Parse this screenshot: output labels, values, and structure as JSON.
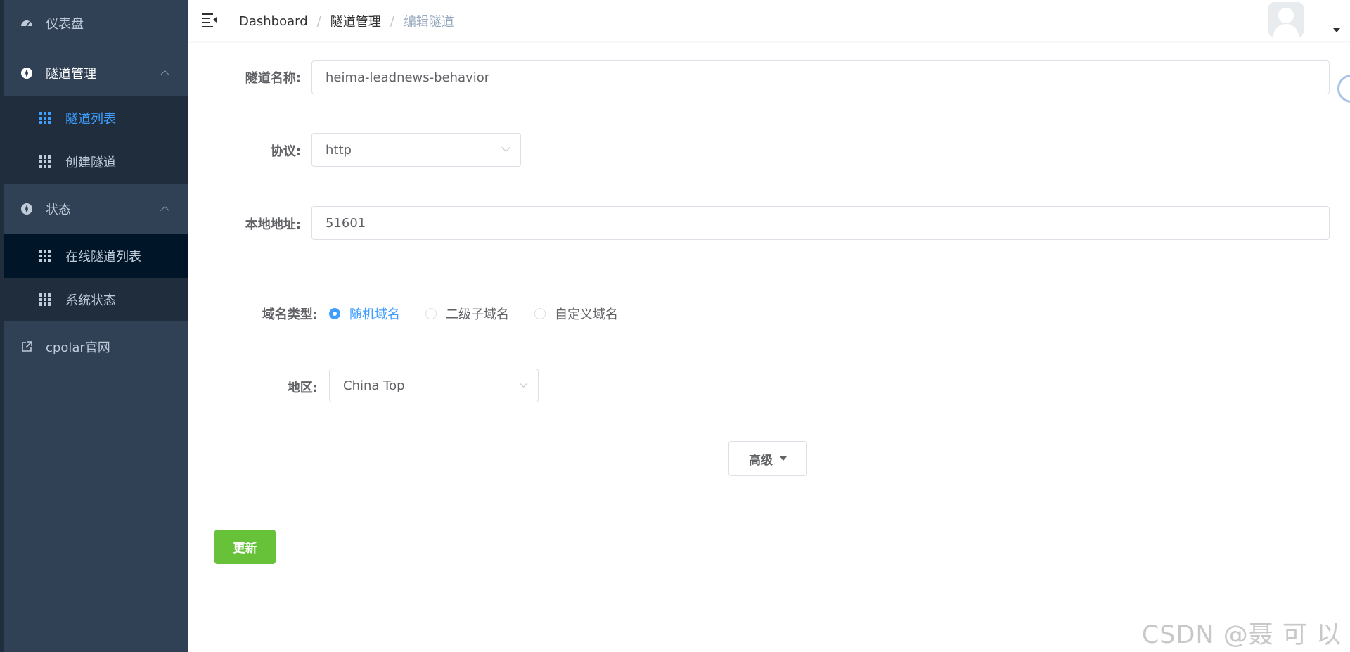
{
  "sidebar": {
    "dashboard": "仪表盘",
    "tunnel_mgmt": "隧道管理",
    "tunnel_list": "隧道列表",
    "create_tunnel": "创建隧道",
    "status": "状态",
    "online_tunnels": "在线隧道列表",
    "system_status": "系统状态",
    "official_site": "cpolar官网"
  },
  "breadcrumb": {
    "home": "Dashboard",
    "sep1": "/",
    "section": "隧道管理",
    "sep2": "/",
    "current": "编辑隧道"
  },
  "form": {
    "tunnel_name_label": "隧道名称:",
    "tunnel_name_value": "heima-leadnews-behavior",
    "protocol_label": "协议:",
    "protocol_value": "http",
    "local_addr_label": "本地地址:",
    "local_addr_value": "51601",
    "domain_type_label": "域名类型:",
    "domain_types": [
      "随机域名",
      "二级子域名",
      "自定义域名"
    ],
    "domain_type_selected": "随机域名",
    "region_label": "地区:",
    "region_value": "China Top",
    "advanced_label": "高级",
    "submit_label": "更新"
  },
  "watermark": "CSDN @聂 可 以",
  "colors": {
    "sidebar_bg": "#304156",
    "active": "#409eff",
    "submit": "#67c23a"
  }
}
